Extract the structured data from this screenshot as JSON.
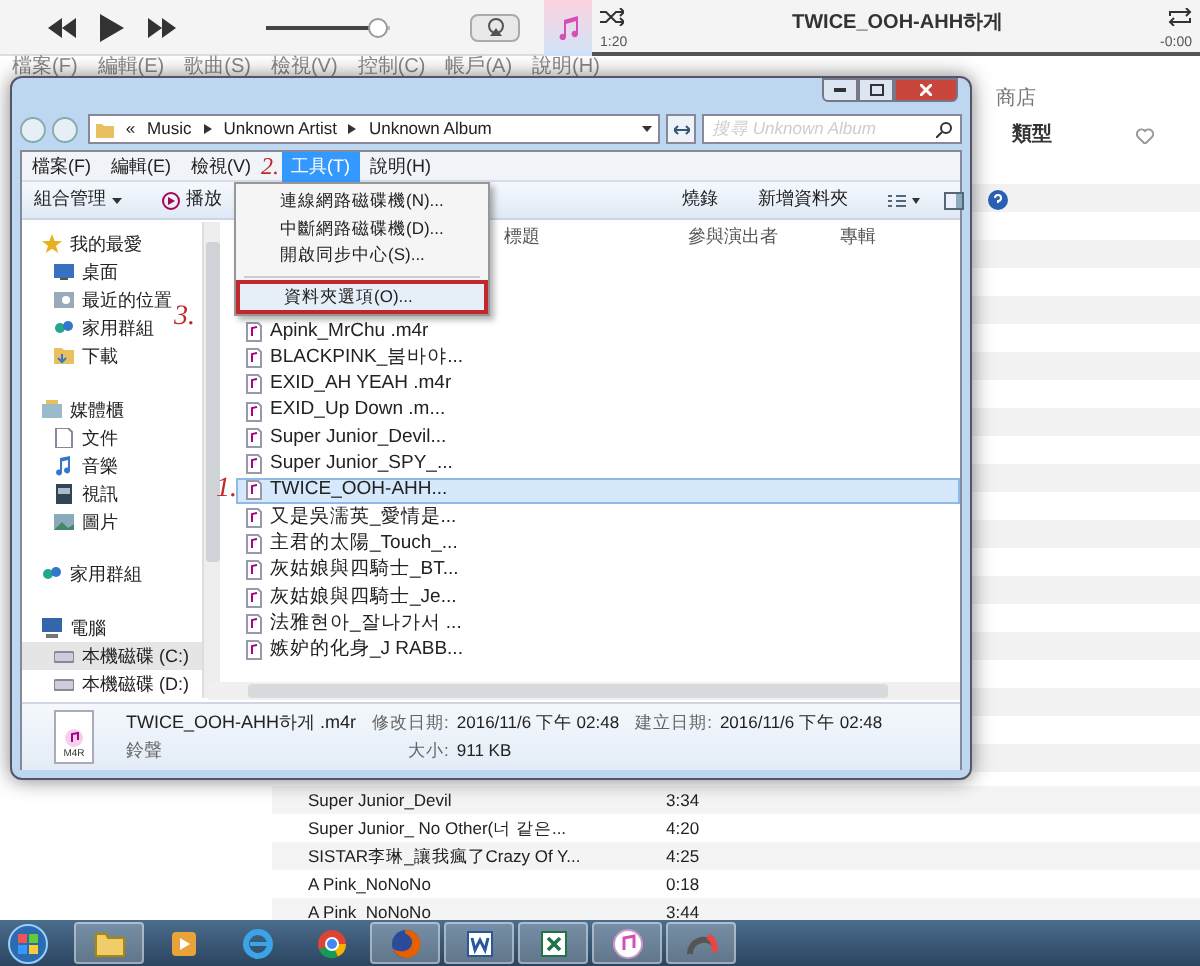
{
  "itunes": {
    "now_playing": {
      "title": "TWICE_OOH-AHH하게",
      "elapsed": "1:20",
      "remaining": "-0:00",
      "level": 1
    },
    "volume": {
      "level": 0.9
    },
    "menu": [
      "檔案(F)",
      "編輯(E)",
      "歌曲(S)",
      "檢視(V)",
      "控制(C)",
      "帳戶(A)",
      "說明(H)"
    ],
    "store_tab": "商店",
    "column": "類型",
    "songs": [
      {
        "title": "Super Junior_Devil",
        "time": "3:34"
      },
      {
        "title": "Super Junior_ No Other(너 같은...",
        "time": "4:20"
      },
      {
        "title": "SISTAR李琳_讓我瘋了Crazy Of Y...",
        "time": "4:25"
      },
      {
        "title": "A Pink_NoNoNo",
        "time": "0:18"
      },
      {
        "title": "A Pink_NoNoNo",
        "time": "3:44"
      }
    ]
  },
  "explorer": {
    "path": [
      "Music",
      "Unknown Artist",
      "Unknown Album"
    ],
    "path_prefix": "«",
    "search": {
      "placeholder": "搜尋 Unknown Album"
    },
    "menu": [
      {
        "label": "檔案(F)",
        "selected": false
      },
      {
        "label": "編輯(E)",
        "selected": false
      },
      {
        "label": "檢視(V)",
        "selected": false
      },
      {
        "label": "工具(T)",
        "selected": true
      },
      {
        "label": "說明(H)",
        "selected": false
      }
    ],
    "tools_menu": [
      {
        "label": "連線網路磁碟機(N)...",
        "selected": false
      },
      {
        "label": "中斷網路磁碟機(D)...",
        "selected": false
      },
      {
        "label": "開啟同步中心(S)...",
        "selected": false
      },
      {
        "label": "資料夾選項(O)...",
        "selected": true
      }
    ],
    "toolbar": [
      {
        "label": "組合管理",
        "kind": "dropdown"
      },
      {
        "label": "播放",
        "kind": "play"
      },
      {
        "label": "燒錄",
        "kind": "plain"
      },
      {
        "label": "新增資料夾",
        "kind": "plain"
      }
    ],
    "columns": [
      "標題",
      "參與演出者",
      "專輯"
    ],
    "nav": [
      {
        "label": "我的最愛",
        "selected": false,
        "children": [
          {
            "label": "桌面",
            "selected": false
          },
          {
            "label": "最近的位置",
            "selected": false
          },
          {
            "label": "家用群組",
            "selected": false
          },
          {
            "label": "下載",
            "selected": false
          }
        ]
      },
      {
        "label": "媒體櫃",
        "selected": false,
        "children": [
          {
            "label": "文件",
            "selected": false
          },
          {
            "label": "音樂",
            "selected": false
          },
          {
            "label": "視訊",
            "selected": false
          },
          {
            "label": "圖片",
            "selected": false
          }
        ]
      },
      {
        "label": "家用群組",
        "selected": false
      },
      {
        "label": "電腦",
        "selected": false,
        "children": [
          {
            "label": "本機磁碟 (C:)",
            "selected": true
          },
          {
            "label": "本機磁碟 (D:)",
            "selected": false
          }
        ]
      }
    ],
    "files": [
      {
        "name": "Apink_MrChu .m4r",
        "selected": false
      },
      {
        "name": "BLACKPINK_붐바야...",
        "selected": false
      },
      {
        "name": "EXID_AH YEAH .m4r",
        "selected": false
      },
      {
        "name": "EXID_Up  Down .m...",
        "selected": false
      },
      {
        "name": "Super Junior_Devil...",
        "selected": false
      },
      {
        "name": "Super Junior_SPY_...",
        "selected": false
      },
      {
        "name": "TWICE_OOH-AHH...",
        "selected": true
      },
      {
        "name": "又是吳濡英_愛情是...",
        "selected": false
      },
      {
        "name": "主君的太陽_Touch_...",
        "selected": false
      },
      {
        "name": "灰姑娘與四騎士_BT...",
        "selected": false
      },
      {
        "name": "灰姑娘與四騎士_Je...",
        "selected": false
      },
      {
        "name": "法雅현아_잘나가서 ...",
        "selected": false
      },
      {
        "name": "嫉妒的化身_J RABB...",
        "selected": false
      }
    ],
    "details": {
      "name": "TWICE_OOH-AHH하게 .m4r",
      "type": "鈴聲",
      "modified_label": "修改日期:",
      "modified": "2016/11/6 下午 02:48",
      "created_label": "建立日期:",
      "created": "2016/11/6 下午 02:48",
      "size_label": "大小:",
      "size": "911 KB",
      "icon_text": "M4R"
    }
  },
  "annotations": [
    "2.",
    "3.",
    "1."
  ],
  "taskbar": [
    {
      "active": true
    },
    {
      "active": false
    },
    {
      "active": false
    },
    {
      "active": false
    },
    {
      "active": true
    },
    {
      "active": true
    },
    {
      "active": true
    },
    {
      "active": true
    },
    {
      "active": true
    }
  ]
}
